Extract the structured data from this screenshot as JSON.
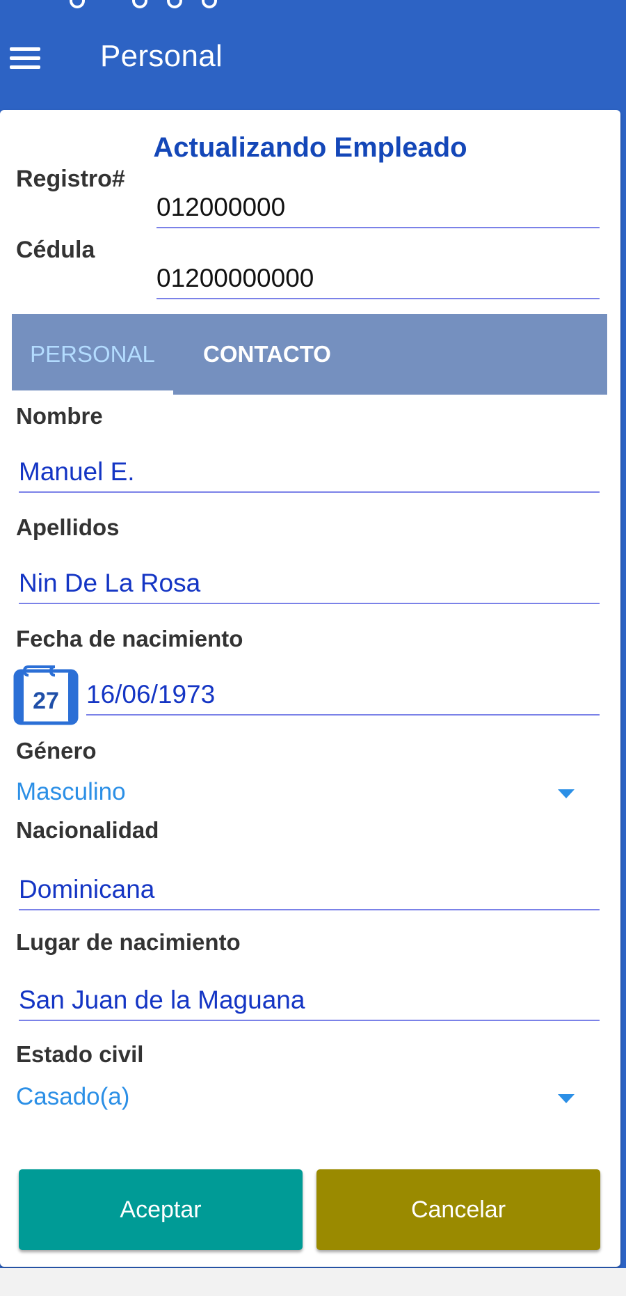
{
  "appbar": {
    "title": "Personal"
  },
  "form": {
    "title": "Actualizando Empleado",
    "registro": {
      "label": "Registro#",
      "value": "012000000"
    },
    "cedula": {
      "label": "Cédula",
      "value": "01200000000"
    }
  },
  "tabs": [
    {
      "label": "PERSONAL",
      "active": true
    },
    {
      "label": "CONTACTO",
      "active": false
    }
  ],
  "personal": {
    "nombre": {
      "label": "Nombre",
      "value": "Manuel E."
    },
    "apellidos": {
      "label": "Apellidos",
      "value": "Nin De La Rosa"
    },
    "fecha_nacimiento": {
      "label": "Fecha de nacimiento",
      "value": "16/06/1973",
      "calendar_day": "27"
    },
    "genero": {
      "label": "Género",
      "value": "Masculino"
    },
    "nacionalidad": {
      "label": "Nacionalidad",
      "value": "Dominicana"
    },
    "lugar_nacimiento": {
      "label": "Lugar de nacimiento",
      "value": "San Juan de la Maguana"
    },
    "estado_civil": {
      "label": "Estado civil",
      "value": "Casado(a)"
    }
  },
  "buttons": {
    "accept": "Aceptar",
    "cancel": "Cancelar"
  },
  "colors": {
    "appbar": "#2d63c4",
    "title": "#1447b8",
    "tabbar": "#7590bf",
    "input_text": "#1435c4",
    "select_text": "#2b8fe6",
    "accept": "#009b96",
    "cancel": "#9a8a00"
  },
  "icons": {
    "menu": "hamburger-menu-icon",
    "calendar": "calendar-icon",
    "dropdown": "dropdown-arrow-icon"
  }
}
